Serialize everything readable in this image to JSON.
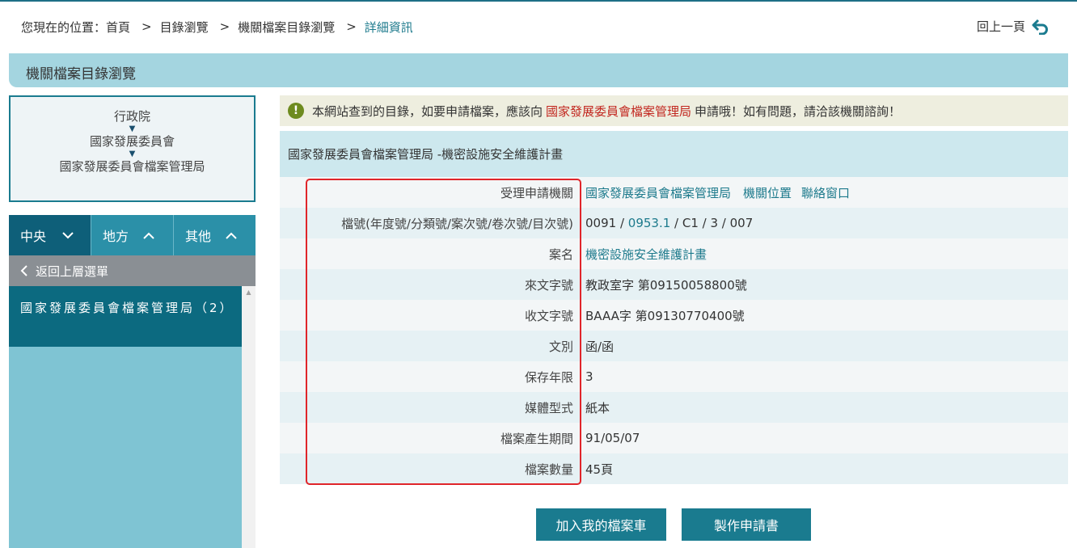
{
  "breadcrumb": {
    "prefix": "您現在的位置：",
    "items": [
      "首頁",
      "目錄瀏覽",
      "機關檔案目錄瀏覽",
      "詳細資訊"
    ],
    "separator": ">"
  },
  "back_link": {
    "label": "回上一頁",
    "icon": "back-arrow-icon"
  },
  "section": {
    "title": "機關檔案目錄瀏覽"
  },
  "sidebar": {
    "hierarchy": [
      "行政院",
      "國家發展委員會",
      "國家發展委員會檔案管理局"
    ],
    "tabs": [
      {
        "label": "中央",
        "icon": "chevron-down-icon"
      },
      {
        "label": "地方",
        "icon": "chevron-up-icon"
      },
      {
        "label": "其他",
        "icon": "chevron-up-icon"
      }
    ],
    "back_menu": "返回上層選單",
    "org_item": "國家發展委員會檔案管理局（2）"
  },
  "notice": {
    "before": "本網站查到的目錄，如要申請檔案，應該向",
    "agency": "國家發展委員會檔案管理局",
    "after": "申請哦！如有問題，請洽該機關諮詢！"
  },
  "record": {
    "title": "國家發展委員會檔案管理局 -機密設施安全維護計畫",
    "fields": {
      "agency_label": "受理申請機關",
      "agency_name": "國家發展委員會檔案管理局",
      "agency_location": "機關位置",
      "agency_contact": "聯絡窗口",
      "fileno_label": "檔號(年度號/分類號/案次號/卷次號/目次號)",
      "fileno_year": "0091",
      "fileno_class": "0953.1",
      "fileno_rest": "C1 / 3 / 007",
      "case_label": "案名",
      "case_value": "機密設施安全維護計畫",
      "incoming_label": "來文字號",
      "incoming_value": "教政室字 第09150058800號",
      "received_label": "收文字號",
      "received_value": "BAAA字 第09130770400號",
      "type_label": "文別",
      "type_value": "函/函",
      "retention_label": "保存年限",
      "retention_value": "3",
      "media_label": "媒體型式",
      "media_value": "紙本",
      "period_label": "檔案產生期間",
      "period_value": "91/05/07",
      "count_label": "檔案數量",
      "count_value": "45頁"
    }
  },
  "buttons": {
    "add_cart": "加入我的檔案車",
    "make_application": "製作申請書"
  }
}
